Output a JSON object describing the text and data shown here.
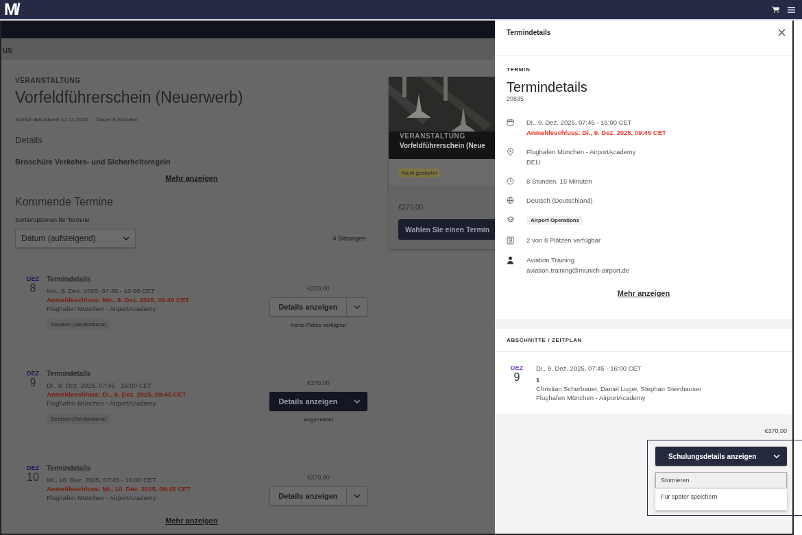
{
  "top_bar": {
    "logo": "M/"
  },
  "page": {
    "breadcrumb": "us",
    "event": {
      "eyebrow": "VERANSTALTUNG",
      "title": "Vorfeldführerschein (Neuerwerb)",
      "meta": [
        {
          "label": "Zuletzt aktualisiert",
          "value": "12.11.2025"
        },
        {
          "label": "Dauer",
          "value": "8 Stunden"
        }
      ],
      "details_heading": "Details",
      "brochure": "Broschüre Verkehrs- und Sicherheitsregeln",
      "more_link": "Mehr anzeigen"
    },
    "upcoming": {
      "heading": "Kommende Termine",
      "sort_label": "Sortieroptionen für Termine",
      "sort_value": "Datum (aufsteigend)",
      "sessions_count": "4 Sitzungen",
      "sessions": [
        {
          "month": "DEZ",
          "day": "8",
          "title": "Termindetails",
          "time": "Mo., 8. Dez. 2025, 07:45 - 16:00 CET",
          "deadline": "Anmeldeschluss: Mo., 8. Dez. 2025, 09:45 CET",
          "location": "Flughafen München - AirportAcademy",
          "tag": "Deutsch (Deutschland)",
          "price": "€370,00",
          "button": "Details anzeigen",
          "kind": "secondary",
          "status": "Keine Plätze verfügbar"
        },
        {
          "month": "DEZ",
          "day": "9",
          "title": "Termindetails",
          "time": "Di., 9. Dez. 2025, 07:45 - 16:00 CET",
          "deadline": "Anmeldeschluss: Di., 9. Dez. 2025, 09:45 CET",
          "location": "Flughafen München - AirportAcademy",
          "tag": "Deutsch (Deutschland)",
          "price": "€370,00",
          "button": "Details anzeigen",
          "kind": "primary",
          "status": "Angemeldet"
        },
        {
          "month": "DEZ",
          "day": "10",
          "title": "Termindetails",
          "time": "Mi., 10. Dez. 2025, 07:45 - 16:00 CET",
          "deadline": "Anmeldeschluss: Mi., 10. Dez. 2025, 09:45 CET",
          "location": "Flughafen München - AirportAcademy",
          "price": "€370,00",
          "button": "Details anzeigen",
          "kind": "secondary"
        }
      ],
      "more_link": "Mehr anzeigen"
    },
    "card": {
      "eyebrow": "VERANSTALTUNG",
      "title": "Vorfeldführerschein (Neue",
      "status_badge": "Nicht gestartet",
      "price": "€370,00",
      "button": "Wahlen Sie einen Termin"
    }
  },
  "drawer": {
    "header": "Termindetails",
    "eyebrow": "TERMIN",
    "title": "Termindetails",
    "number": "20835",
    "rows": [
      {
        "kind": "text",
        "lines": [
          {
            "text": "Di., 9. Dez. 2025, 07:45 - 16:00 CET",
            "alert": false
          },
          {
            "text": "Anmeldeschluss: Di., 9. Dez. 2025, 09:45 CET",
            "alert": true
          }
        ]
      },
      {
        "kind": "text",
        "lines": [
          {
            "text": "Flughafen München - AirportAcademy",
            "alert": false
          },
          {
            "text": "DEU",
            "alert": false
          }
        ]
      },
      {
        "kind": "text",
        "lines": [
          {
            "text": "8 Stunden, 15 Minuten",
            "alert": false
          }
        ]
      },
      {
        "kind": "text",
        "lines": [
          {
            "text": "Deutsch (Deutschland)",
            "alert": false
          }
        ]
      },
      {
        "kind": "tag",
        "lines": [
          {
            "text": "Airport Operations"
          }
        ]
      },
      {
        "kind": "text",
        "lines": [
          {
            "text": "2 von 8 Plätzen verfügbar",
            "alert": false
          }
        ]
      },
      {
        "kind": "text",
        "lines": [
          {
            "text": "Aviation Training",
            "alert": false
          },
          {
            "text": "aviation.training@munich-airport.de",
            "alert": false
          }
        ]
      }
    ],
    "more_link": "Mehr anzeigen",
    "schedule": {
      "heading": "ABSCHNITTE / ZEITPLAN",
      "month": "DEZ",
      "day": "9",
      "time": "Di., 9. Dez. 2025, 07:45 - 16:00 CET",
      "number": "1",
      "trainers": "Christian Scherbauer, Daniel Luger, Stephan Steinhauser",
      "location": "Flughafen München - AirportAcademy"
    },
    "price": "€370,00",
    "action": {
      "button": "Schulungsdetails anzeigen",
      "menu": [
        {
          "label": "Stornieren",
          "selected": true
        },
        {
          "label": "Für später speichern",
          "selected": false
        }
      ]
    }
  }
}
